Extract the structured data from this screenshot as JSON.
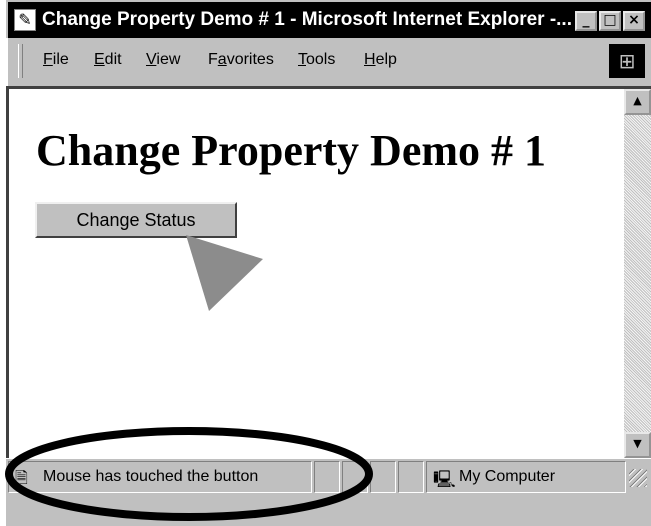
{
  "window": {
    "title": "Change Property Demo # 1 - Microsoft Internet Explorer -...",
    "minimize": "_",
    "maximize": "□",
    "close": "×"
  },
  "menu": {
    "items": [
      {
        "key": "F",
        "rest": "ile"
      },
      {
        "key": "E",
        "rest": "dit"
      },
      {
        "key": "V",
        "rest": "iew"
      },
      {
        "pre": "F",
        "key": "a",
        "rest": "vorites"
      },
      {
        "key": "T",
        "rest": "ools"
      },
      {
        "key": "H",
        "rest": "elp"
      }
    ]
  },
  "page": {
    "heading": "Change Property Demo # 1",
    "button_label": "Change Status"
  },
  "scrollbar": {
    "up": "▲",
    "down": "▼"
  },
  "status": {
    "message": "Mouse has touched the button",
    "zone": "My Computer"
  },
  "icons": {
    "window": "ie-page-icon",
    "logo": "windows-logo-icon",
    "status": "page-icon",
    "zone": "computer-icon",
    "callout_arrow": "pointer-arrow",
    "callout_ellipse": "highlight-ellipse"
  }
}
